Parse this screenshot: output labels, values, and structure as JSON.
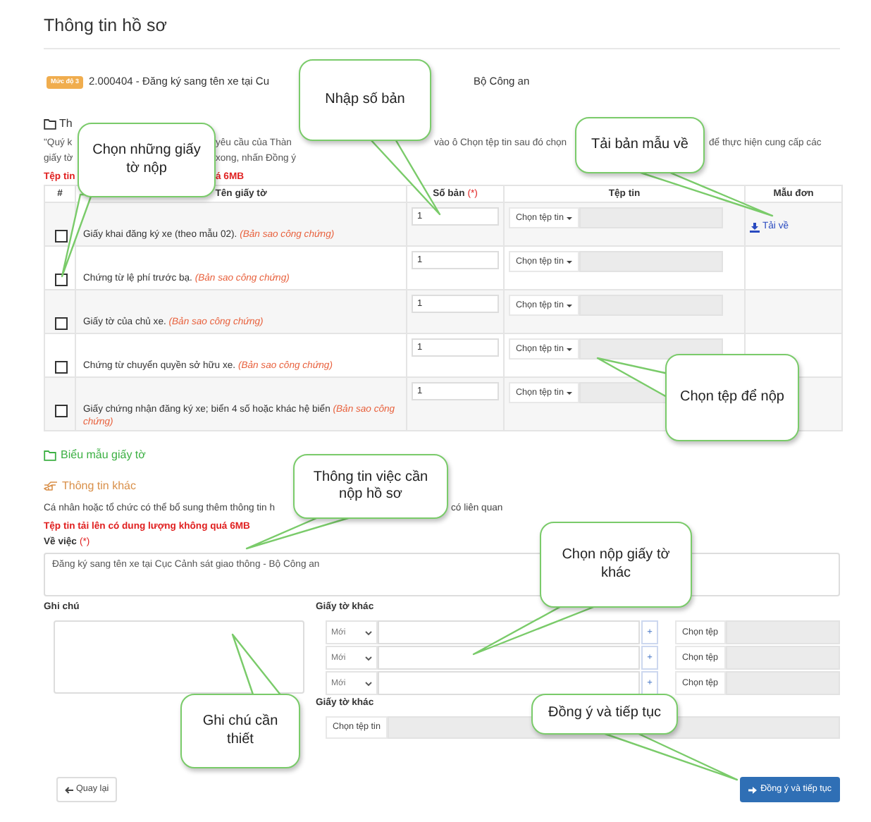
{
  "page_title": "Thông tin hồ sơ",
  "procedure": {
    "badge": "Mức độ 3",
    "title_parts": [
      "2.000404 - Đăng ký sang tên xe tại Cu",
      "Bộ Công an"
    ]
  },
  "documents_section": {
    "heading": "Th",
    "instructions": [
      [
        "\"Quý k",
        "yêu cầu của Thàn",
        "vào ô Chọn tệp tin sau đó chọn",
        "để thực hiện cung cấp các"
      ],
      [
        "giấy tờ",
        "xong, nhấn Đồng ý"
      ]
    ],
    "warning_parts": [
      "Tệp tin",
      "á 6MB"
    ]
  },
  "table": {
    "columns": [
      {
        "label": "#"
      },
      {
        "label": "Tên giấy tờ"
      },
      {
        "label": "Số bản",
        "required_mark": "(*)"
      },
      {
        "label": "Tệp tin"
      },
      {
        "label": "Mẫu đơn"
      }
    ],
    "rows": [
      {
        "checked": false,
        "name": "Giấy khai đăng ký xe (theo mẫu 02).",
        "note": "(Bản sao công chứng)",
        "copies": "1",
        "file_button": "Chọn tệp tin",
        "template_link": "Tải về"
      },
      {
        "checked": false,
        "name": "Chứng từ lệ phí trước bạ.",
        "note": "(Bản sao công chứng)",
        "copies": "1",
        "file_button": "Chọn tệp tin"
      },
      {
        "checked": false,
        "name": "Giấy tờ của chủ xe.",
        "note": "(Bản sao công chứng)",
        "copies": "1",
        "file_button": "Chọn tệp tin"
      },
      {
        "checked": false,
        "name": "Chứng từ chuyển quyền sở hữu xe.",
        "note": "(Bản sao công chứng)",
        "copies": "1",
        "file_button": "Chọn tệp tin"
      },
      {
        "checked": false,
        "name": "Giấy chứng nhận đăng ký xe; biển 4 số hoặc khác hệ biển",
        "note": "(Bản sao công chứng)",
        "copies": "1",
        "file_button": "Chọn tệp tin"
      }
    ]
  },
  "forms_link": "Biểu mẫu giấy tờ",
  "other_info": {
    "heading": "Thông tin khác",
    "description_parts": [
      "Cá nhân hoặc tổ chức có thể bổ sung thêm thông tin h",
      "có liên quan"
    ],
    "warning": "Tệp tin tải lên có dung lượng không quá 6MB",
    "subject": {
      "label": "Về việc",
      "required_mark": "(*)",
      "value": "Đăng ký sang tên xe tại Cục Cảnh sát giao thông - Bộ Công an"
    },
    "note": {
      "label": "Ghi chú"
    },
    "other_papers": {
      "label": "Giấy tờ khác",
      "rows": [
        {
          "type": "Mới",
          "add": "+",
          "file_button": "Chọn tệp"
        },
        {
          "type": "Mới",
          "add": "+",
          "file_button": "Chọn tệp"
        },
        {
          "type": "Mới",
          "add": "+",
          "file_button": "Chọn tệp"
        }
      ]
    },
    "other_upload": {
      "label": "Giấy tờ khác",
      "file_button": "Chọn tệp tin"
    }
  },
  "buttons": {
    "back": "Quay lại",
    "submit": "Đồng ý và tiếp tục"
  },
  "callouts": [
    {
      "text": "Chọn những giấy tờ nộp"
    },
    {
      "text": "Nhập số bản"
    },
    {
      "text": "Tải bản mẫu về"
    },
    {
      "text": "Chọn tệp để nộp"
    },
    {
      "text": "Thông tin việc cần nộp hồ sơ"
    },
    {
      "text": "Chọn nộp giấy tờ khác"
    },
    {
      "text": "Ghi chú cần thiết"
    },
    {
      "text": "Đồng ý và tiếp tục"
    }
  ]
}
